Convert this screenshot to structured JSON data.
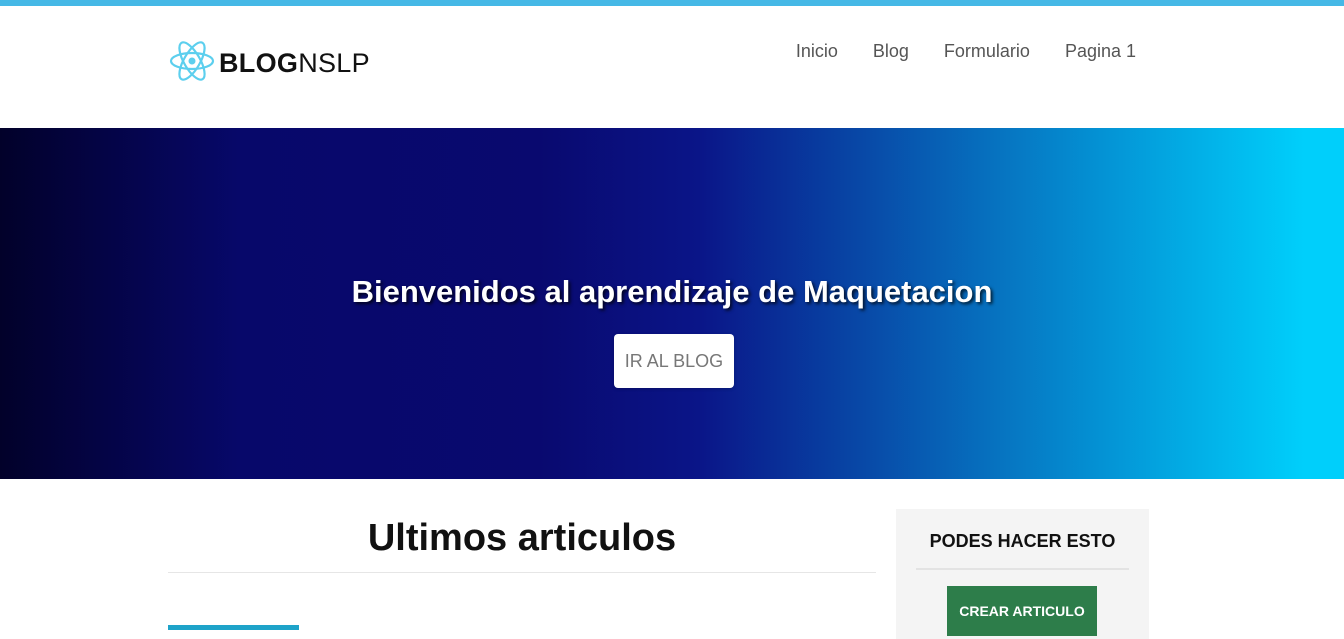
{
  "header": {
    "logo": {
      "bold_text": "BLOG",
      "light_text": "NSLP",
      "icon": "atom-icon"
    },
    "nav": [
      {
        "label": "Inicio"
      },
      {
        "label": "Blog"
      },
      {
        "label": "Formulario"
      },
      {
        "label": "Pagina 1"
      }
    ]
  },
  "hero": {
    "title": "Bienvenidos al aprendizaje de Maquetacion",
    "button_label": "IR AL BLOG",
    "gradient_colors": [
      "#02012a",
      "#07086a",
      "#0a1588",
      "#0676c2",
      "#00cffb"
    ]
  },
  "main": {
    "articles_title": "Ultimos articulos"
  },
  "sidebar": {
    "title": "PODES HACER ESTO",
    "button_label": "CREAR ARTICULO",
    "button_color": "#2d7d4a"
  },
  "colors": {
    "accent": "#45b8e6"
  }
}
